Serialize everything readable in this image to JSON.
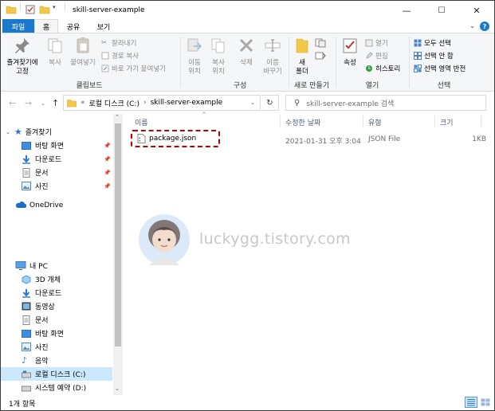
{
  "window": {
    "title": "skill-server-example",
    "minimize": "—",
    "maximize": "☐",
    "close": "✕"
  },
  "tabs": {
    "file": "파일",
    "home": "홈",
    "share": "공유",
    "view": "보기"
  },
  "ribbon": {
    "pin_quick": "즐겨찾기에\n고정",
    "copy": "복사",
    "paste": "붙여넣기",
    "cut": "잘라내기",
    "copy_path": "경로 복사",
    "paste_shortcut": "바로 가기 붙여넣기",
    "group_clipboard": "클립보드",
    "move_to": "이동\n위치",
    "copy_to": "복사\n위치",
    "delete": "삭제",
    "rename": "이름\n바꾸기",
    "group_organize": "구성",
    "new_folder": "새\n폴더",
    "group_new": "새로 만들기",
    "properties": "속성",
    "open": "열기",
    "edit": "편집",
    "history": "히스토리",
    "group_open": "열기",
    "select_all": "모두 선택",
    "select_none": "선택 안 함",
    "invert_selection": "선택 영역 반전",
    "group_select": "선택"
  },
  "address": {
    "prefix": "«",
    "drive": "로컬 디스크 (C:)",
    "sep": "›",
    "folder": "skill-server-example",
    "search_placeholder": "skill-server-example 검색"
  },
  "nav": {
    "quick_access": "즐겨찾기",
    "qa_items": [
      "바탕 화면",
      "다운로드",
      "문서",
      "사진"
    ],
    "onedrive": "OneDrive",
    "this_pc": "내 PC",
    "pc_items": [
      "3D 개체",
      "다운로드",
      "동영상",
      "문서",
      "바탕 화면",
      "사진",
      "음악",
      "로컬 디스크 (C:)",
      "시스템 예약 (D:)"
    ]
  },
  "columns": {
    "name": "이름",
    "modified": "수정한 날짜",
    "type": "유형",
    "size": "크기"
  },
  "files": [
    {
      "name": "package.json",
      "modified": "2021-01-31 오후 3:04",
      "type": "JSON File",
      "size": "1KB"
    }
  ],
  "watermark": "luckygg.tistory.com",
  "status": {
    "count": "1개 항목"
  },
  "colors": {
    "accent": "#1979ca",
    "selection": "#cce8ff",
    "highlight_border": "#c00000"
  }
}
